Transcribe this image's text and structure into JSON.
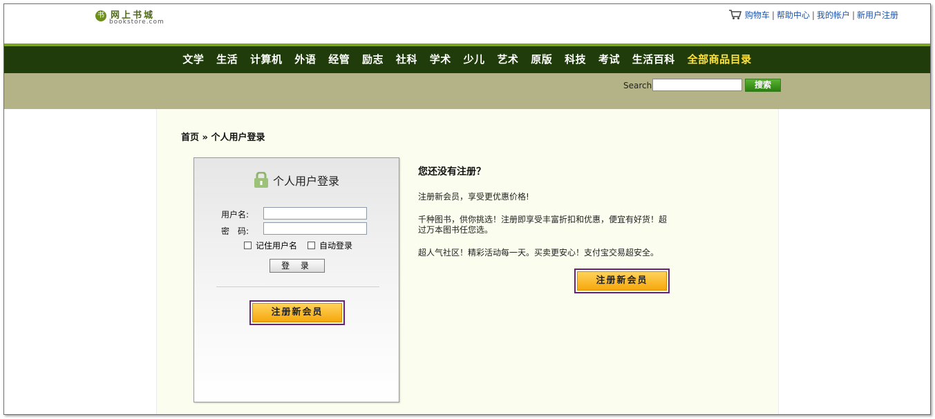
{
  "header": {
    "logo_cn": "网上书城",
    "logo_en": "bookstore.com",
    "links": [
      "购物车",
      "帮助中心",
      "我的帐户",
      "新用户注册"
    ]
  },
  "nav": {
    "items": [
      "文学",
      "生活",
      "计算机",
      "外语",
      "经管",
      "励志",
      "社科",
      "学术",
      "少儿",
      "艺术",
      "原版",
      "科技",
      "考试",
      "生活百科",
      "全部商品目录"
    ]
  },
  "search": {
    "label": "Search",
    "value": "",
    "button": "搜索"
  },
  "breadcrumb": "首页 » 个人用户登录",
  "login": {
    "title": "个人用户登录",
    "username_label": "用户名:",
    "password_label": "密　码:",
    "username_value": "",
    "password_value": "",
    "remember_label": "记住用户名",
    "remember_checked": false,
    "auto_label": "自动登录",
    "auto_checked": false,
    "login_button": "登 录",
    "register_button": "注册新会员"
  },
  "info": {
    "heading": "您还没有注册？",
    "p1": "注册新会员，享受更优惠价格!",
    "p2": "千种图书，供你挑选！注册即享受丰富折扣和优惠，便宜有好货！超过万本图书任您选。",
    "p3": "超人气社区！精彩活动每一天。买卖更安心！支付宝交易超安全。",
    "register_button": "注册新会员"
  },
  "colors": {
    "nav_bg": "#1f3c0a",
    "nav_accent": "#ffe23b",
    "search_bar_bg": "#b3b387",
    "content_bg": "#fbfdee",
    "register_border": "#6b1f7a",
    "register_fill": "#f6a70c"
  },
  "icons": {
    "cart": "cart-icon",
    "lock": "lock-icon",
    "logo": "logo-seal-icon"
  }
}
